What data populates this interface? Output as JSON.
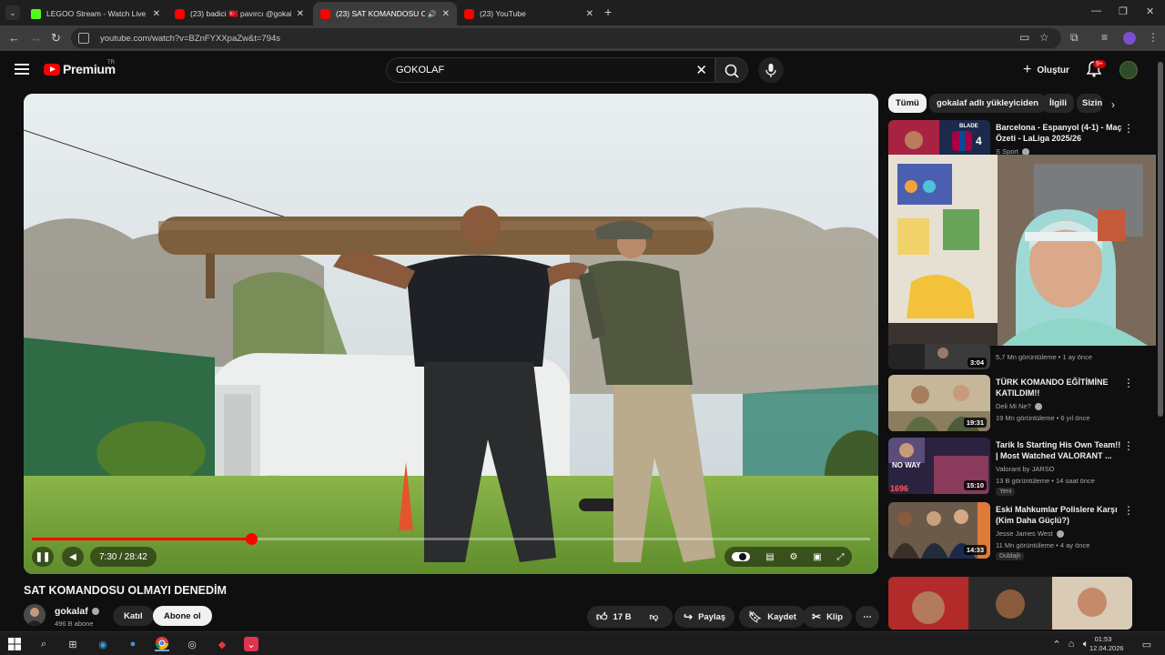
{
  "browser": {
    "tabs": [
      {
        "title": "LEGOO Stream - Watch Live on",
        "color": "#53fc18",
        "active": false
      },
      {
        "title": "(23) badici 🇹🇷 pavırcı @gokala",
        "color": "#ff0000",
        "active": false
      },
      {
        "title": "(23) SAT KOMANDOSU OL",
        "color": "#ff0000",
        "active": true
      },
      {
        "title": "(23) YouTube",
        "color": "#ff0000",
        "active": false
      }
    ],
    "url": "youtube.com/watch?v=BZnFYXXpaZw&t=794s"
  },
  "header": {
    "logo_text": "Premium",
    "logo_region": "TR",
    "search_query": "GOKOLAF",
    "create_label": "Oluştur",
    "notif_count": "9+"
  },
  "player": {
    "time": "7:30 / 28:42",
    "progress": 0.2613
  },
  "video": {
    "title": "SAT KOMANDOSU OLMAYI DENEDİM",
    "channel": "gokalaf",
    "subscribers": "496 B abone",
    "join_label": "Katıl",
    "subscribe_label": "Abone ol",
    "likes": "17 B",
    "share_label": "Paylaş",
    "save_label": "Kaydet",
    "clip_label": "Klip"
  },
  "chips": [
    "Tümü",
    "gokalaf adlı yükleyiciden",
    "İlgili",
    "Sizin"
  ],
  "recommendations": [
    {
      "title": "Barcelona - Espanyol (4-1) - Maç Özeti - LaLiga 2025/26",
      "channel": "S Sport",
      "meta": "",
      "duration": "",
      "tag": ""
    },
    {
      "title": "",
      "channel": "",
      "meta": "5,7 Mn görüntüleme • 1 ay önce",
      "duration": "3:04",
      "tag": ""
    },
    {
      "title": "TÜRK KOMANDO EĞİTİMİNE KATILDIM!!",
      "channel": "Deli Mi Ne?",
      "meta": "19 Mn görüntüleme • 6 yıl önce",
      "duration": "19:31",
      "tag": ""
    },
    {
      "title": "Tarik Is Starting His Own Team!! | Most Watched VALORANT ...",
      "channel": "Valorant by JARSO",
      "meta": "13 B görüntüleme • 14 saat önce",
      "duration": "15:10",
      "tag": "Yeni"
    },
    {
      "title": "Eski Mahkumlar Polislere Karşı (Kim Daha Güçlü?)",
      "channel": "Jesse James West",
      "meta": "11 Mn görüntüleme • 4 ay önce",
      "duration": "14:33",
      "tag": "Dublajlı"
    }
  ],
  "thumb_texts": {
    "blade": "BLADE",
    "num": "4",
    "noway": "NO WAY",
    "price": "1696"
  },
  "taskbar": {
    "time": "01:53",
    "date": "12.04.2026"
  }
}
